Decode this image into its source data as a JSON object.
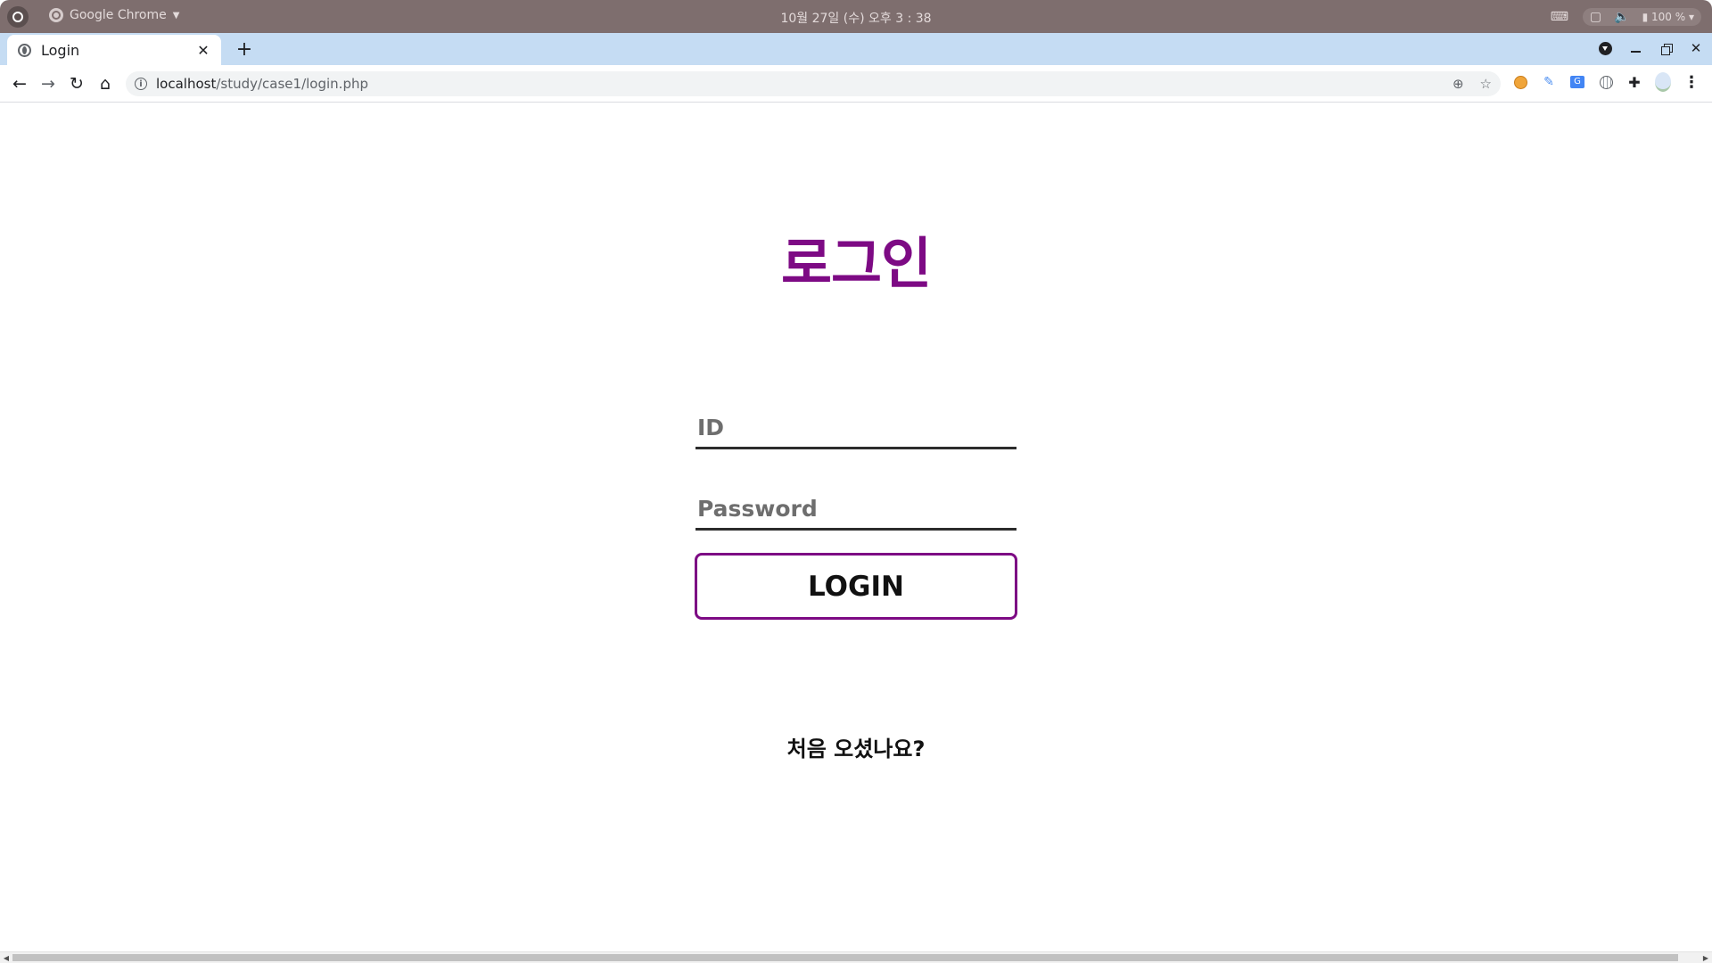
{
  "os_bar": {
    "app_name": "Google Chrome",
    "clock": "10월 27일 (수) 오후 3 : 38",
    "battery": "100 %"
  },
  "tabs": [
    {
      "title": "Login",
      "active": true
    }
  ],
  "toolbar": {
    "url_host": "localhost",
    "url_path": "/study/case1/login.php"
  },
  "page": {
    "title": "로그인",
    "id_placeholder": "ID",
    "password_placeholder": "Password",
    "login_label": "LOGIN",
    "signup_text": "처음 오셨나요?"
  },
  "colors": {
    "accent": "#7d0a84",
    "os_bar": "#7e6e6e",
    "tab_strip": "#c5dcf3"
  },
  "icons": {
    "back": "arrow-left-icon",
    "forward": "arrow-right-icon",
    "reload": "reload-icon",
    "home": "home-icon",
    "site_info": "info-icon",
    "zoom": "zoom-icon",
    "bookmark": "star-icon"
  }
}
